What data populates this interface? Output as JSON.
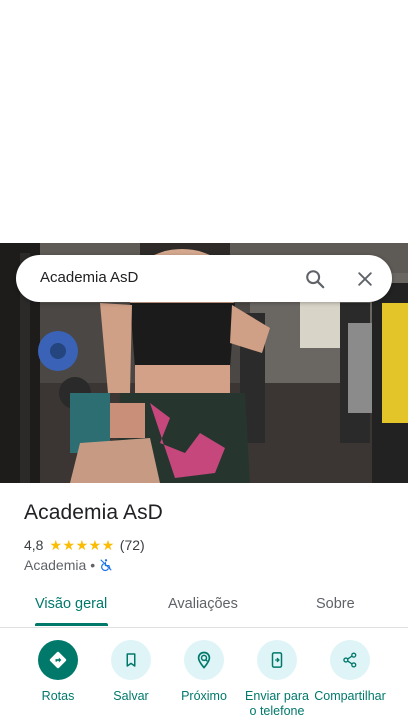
{
  "search": {
    "query": "Academia AsD"
  },
  "place": {
    "title": "Academia AsD",
    "rating": "4,8",
    "review_count": "(72)",
    "category": "Academia",
    "separator": "•"
  },
  "tabs": [
    {
      "label": "Visão geral",
      "active": true
    },
    {
      "label": "Avaliações",
      "active": false
    },
    {
      "label": "Sobre",
      "active": false
    }
  ],
  "actions": [
    {
      "label": "Rotas",
      "icon": "directions-icon"
    },
    {
      "label": "Salvar",
      "icon": "bookmark-icon"
    },
    {
      "label": "Próximo",
      "icon": "nearby-icon"
    },
    {
      "label": "Enviar para o telefone",
      "icon": "send-to-phone-icon"
    },
    {
      "label": "Compartilhar",
      "icon": "share-icon"
    }
  ],
  "colors": {
    "accent": "#00796b",
    "action_bg": "#dff4f7",
    "star": "#fbbc04"
  }
}
